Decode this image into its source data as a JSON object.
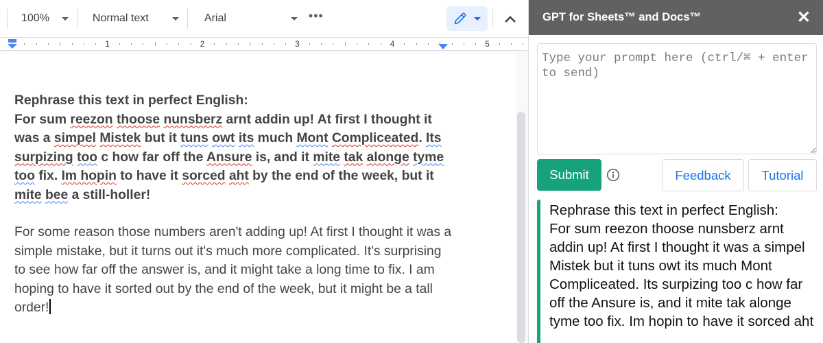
{
  "toolbar": {
    "zoom": "100%",
    "paragraph_style": "Normal text",
    "font": "Arial",
    "more_label": "•••",
    "mode_icon": "pencil-icon",
    "collapse_icon": "chevron-up-icon"
  },
  "ruler": {
    "numbers": [
      "1",
      "2",
      "3",
      "4",
      "5"
    ]
  },
  "document": {
    "prompt_heading": "Rephrase this text in perfect English:",
    "garbled_segments": [
      {
        "t": "For sum ",
        "s": ""
      },
      {
        "t": "reezon",
        "s": "red"
      },
      {
        "t": " ",
        "s": ""
      },
      {
        "t": "thoose",
        "s": "red"
      },
      {
        "t": " ",
        "s": ""
      },
      {
        "t": "nunsberz",
        "s": "red"
      },
      {
        "t": " arnt addin up! At first I thought it was a ",
        "s": ""
      },
      {
        "t": "simpel",
        "s": "red"
      },
      {
        "t": " ",
        "s": ""
      },
      {
        "t": "Mistek",
        "s": "red"
      },
      {
        "t": " but it ",
        "s": ""
      },
      {
        "t": "tuns",
        "s": "blue"
      },
      {
        "t": " ",
        "s": ""
      },
      {
        "t": "owt",
        "s": "blue"
      },
      {
        "t": " ",
        "s": ""
      },
      {
        "t": "its",
        "s": "blue"
      },
      {
        "t": " much ",
        "s": ""
      },
      {
        "t": "Mont",
        "s": "blue"
      },
      {
        "t": " ",
        "s": ""
      },
      {
        "t": "Compliceated",
        "s": "red"
      },
      {
        "t": ". ",
        "s": ""
      },
      {
        "t": "Its",
        "s": "blue"
      },
      {
        "t": " ",
        "s": ""
      },
      {
        "t": "surpizing",
        "s": "red"
      },
      {
        "t": " ",
        "s": ""
      },
      {
        "t": "too",
        "s": "blue"
      },
      {
        "t": " c how far off the ",
        "s": ""
      },
      {
        "t": "Ansure",
        "s": "red"
      },
      {
        "t": " is, and it ",
        "s": ""
      },
      {
        "t": "mite",
        "s": "blue"
      },
      {
        "t": " ",
        "s": ""
      },
      {
        "t": "tak",
        "s": "red"
      },
      {
        "t": " ",
        "s": ""
      },
      {
        "t": "alonge",
        "s": "red"
      },
      {
        "t": " ",
        "s": ""
      },
      {
        "t": "tyme",
        "s": "blue"
      },
      {
        "t": " ",
        "s": ""
      },
      {
        "t": "too",
        "s": "blue"
      },
      {
        "t": " fix. ",
        "s": ""
      },
      {
        "t": "Im hopin",
        "s": "red"
      },
      {
        "t": " to have it ",
        "s": ""
      },
      {
        "t": "sorced",
        "s": "red"
      },
      {
        "t": " ",
        "s": ""
      },
      {
        "t": "aht",
        "s": "red"
      },
      {
        "t": " by the end of the week, but it ",
        "s": ""
      },
      {
        "t": "mite",
        "s": "blue"
      },
      {
        "t": " ",
        "s": ""
      },
      {
        "t": "bee",
        "s": "blue"
      },
      {
        "t": " a still-holler!",
        "s": ""
      }
    ],
    "rephrased": "For some reason those numbers aren't adding up! At first I thought it was a simple mistake, but it turns out it's much more complicated. It's surprising to see how far off the answer is, and it might take a long time to fix. I am hoping to have it sorted out by the end of the week, but it might be a tall order!"
  },
  "panel": {
    "title": "GPT for Sheets™ and Docs™",
    "close_label": "✕",
    "prompt_value": "",
    "prompt_placeholder": "Type your prompt here (ctrl/⌘ + enter to send)",
    "submit_label": "Submit",
    "feedback_label": "Feedback",
    "tutorial_label": "Tutorial",
    "response_text": "Rephrase this text in perfect English:\nFor sum reezon thoose nunsberz arnt addin up! At first I thought it was a simpel Mistek but it tuns owt its much Mont Compliceated. Its surpizing too c how far off the Ansure is, and it mite tak alonge tyme too fix. Im hopin to have it sorced aht"
  },
  "colors": {
    "accent_green": "#16a37c",
    "link_blue": "#1a73e8",
    "panel_header": "#616161",
    "spell_red": "#d93025",
    "grammar_blue": "#4285f4"
  }
}
